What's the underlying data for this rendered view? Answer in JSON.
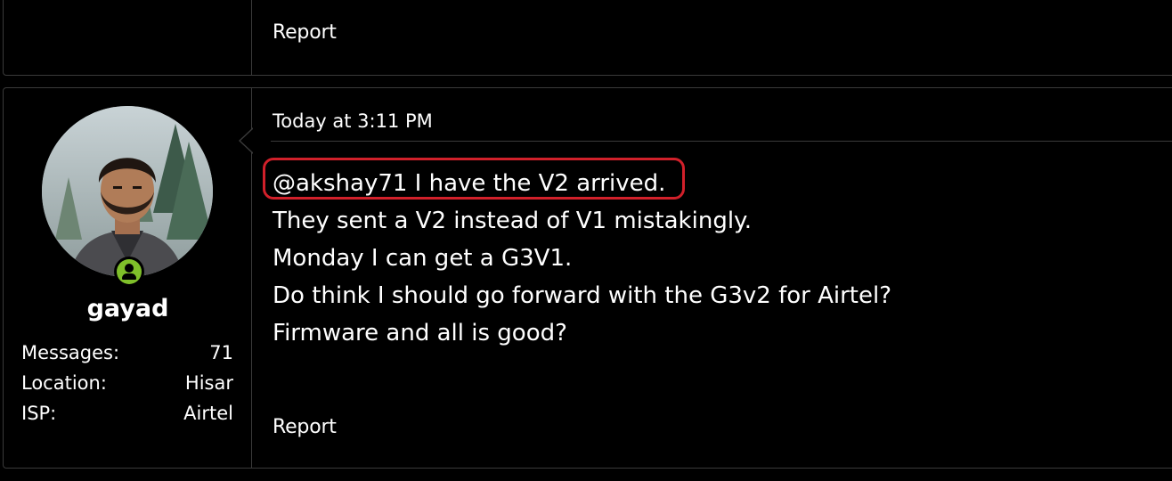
{
  "previous_post": {
    "report_label": "Report"
  },
  "post": {
    "user": {
      "username": "gayad",
      "stats": [
        {
          "label": "Messages:",
          "value": "71"
        },
        {
          "label": "Location:",
          "value": "Hisar"
        },
        {
          "label": "ISP:",
          "value": "Airtel"
        }
      ]
    },
    "timestamp": "Today at 3:11 PM",
    "message_lines": [
      "@akshay71 I have the V2 arrived.",
      "They sent a V2 instead of V1 mistakingly.",
      "Monday I can get a G3V1.",
      "Do think I should go forward with the G3v2 for Airtel?",
      "Firmware and all is good?"
    ],
    "report_label": "Report"
  },
  "colors": {
    "background": "#000000",
    "border": "#3a3a3a",
    "online": "#7fbf2a",
    "highlight": "#d1202a"
  },
  "icons": {
    "online_badge": "user-online-icon"
  }
}
